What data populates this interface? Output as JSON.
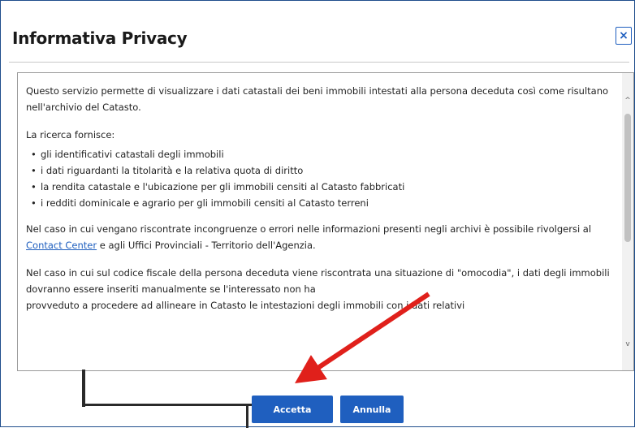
{
  "dialog": {
    "title": "Informativa Privacy",
    "close_label": "×"
  },
  "content": {
    "paragraph1": "Questo servizio permette di visualizzare i dati catastali dei beni immobili intestati alla persona deceduta così come risultano nell'archivio del Catasto.",
    "paragraph2": "La ricerca fornisce:",
    "list": [
      "gli identificativi catastali degli immobili",
      "i dati riguardanti la titolarità e la relativa quota di diritto",
      "la rendita catastale e l'ubicazione per gli immobili censiti al Catasto fabbricati",
      "i redditi dominicale e agrario per gli immobili censiti al Catasto terreni"
    ],
    "paragraph3_before": "Nel caso in cui vengano riscontrate incongruenze o errori nelle informazioni presenti negli archivi è possibile rivolgersi al ",
    "paragraph3_link": "Contact Center",
    "paragraph3_after": " e agli Uffici Provinciali - Territorio dell'Agenzia.",
    "paragraph4": "Nel caso in cui sul codice fiscale della persona deceduta viene riscontrata una situazione di \"omocodia\", i dati degli immobili dovranno essere inseriti manualmente se l'interessato non ha",
    "paragraph4_cut": "provveduto a procedere ad allineare in Catasto le intestazioni degli immobili con i dati relativi"
  },
  "buttons": {
    "accept": "Accetta",
    "cancel": "Annulla"
  },
  "colors": {
    "primary": "#1f5fbf",
    "arrow": "#e0201b"
  }
}
